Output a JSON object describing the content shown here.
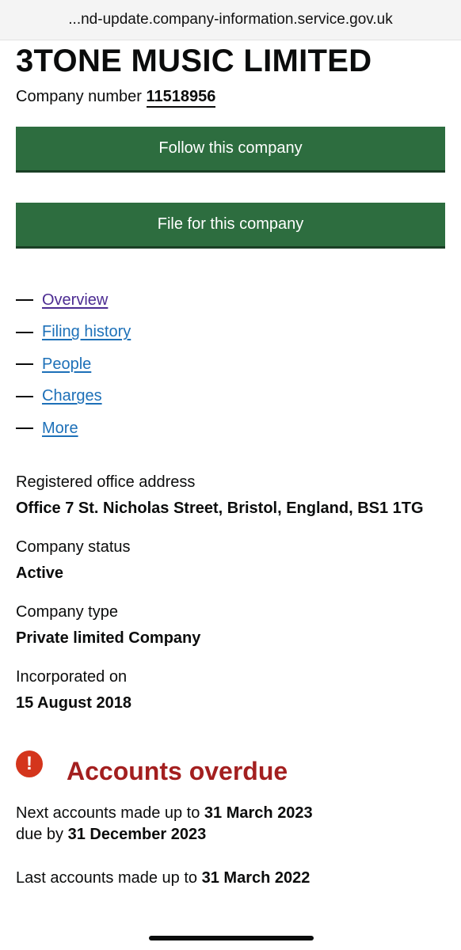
{
  "browser": {
    "url": "...nd-update.company-information.service.gov.uk"
  },
  "company": {
    "name": "3TONE MUSIC LIMITED",
    "number_label": "Company number",
    "number": "11518956"
  },
  "actions": {
    "follow_label": "Follow this company",
    "file_label": "File for this company"
  },
  "nav": {
    "dash": "—",
    "items": [
      {
        "label": "Overview"
      },
      {
        "label": "Filing history"
      },
      {
        "label": "People"
      },
      {
        "label": "Charges"
      },
      {
        "label": "More"
      }
    ]
  },
  "facts": {
    "address_label": "Registered office address",
    "address_value": "Office 7 St. Nicholas Street, Bristol, England, BS1 1TG",
    "status_label": "Company status",
    "status_value": "Active",
    "type_label": "Company type",
    "type_value": "Private limited Company",
    "incorporated_label": "Incorporated on",
    "incorporated_value": "15 August 2018"
  },
  "alert": {
    "icon_symbol": "!",
    "title": "Accounts overdue",
    "color": "#a31f1f",
    "icon_color": "#d4351c"
  },
  "accounts": {
    "next_prefix": "Next accounts made up to",
    "next_date": "31 March 2023",
    "due_prefix": "due by",
    "due_date": "31 December 2023",
    "last_prefix": "Last accounts made up to",
    "last_date": "31 March 2022"
  },
  "colors": {
    "button_green": "#2d6d3f",
    "link_blue": "#1d70b8",
    "link_visited": "#4c2c92"
  }
}
